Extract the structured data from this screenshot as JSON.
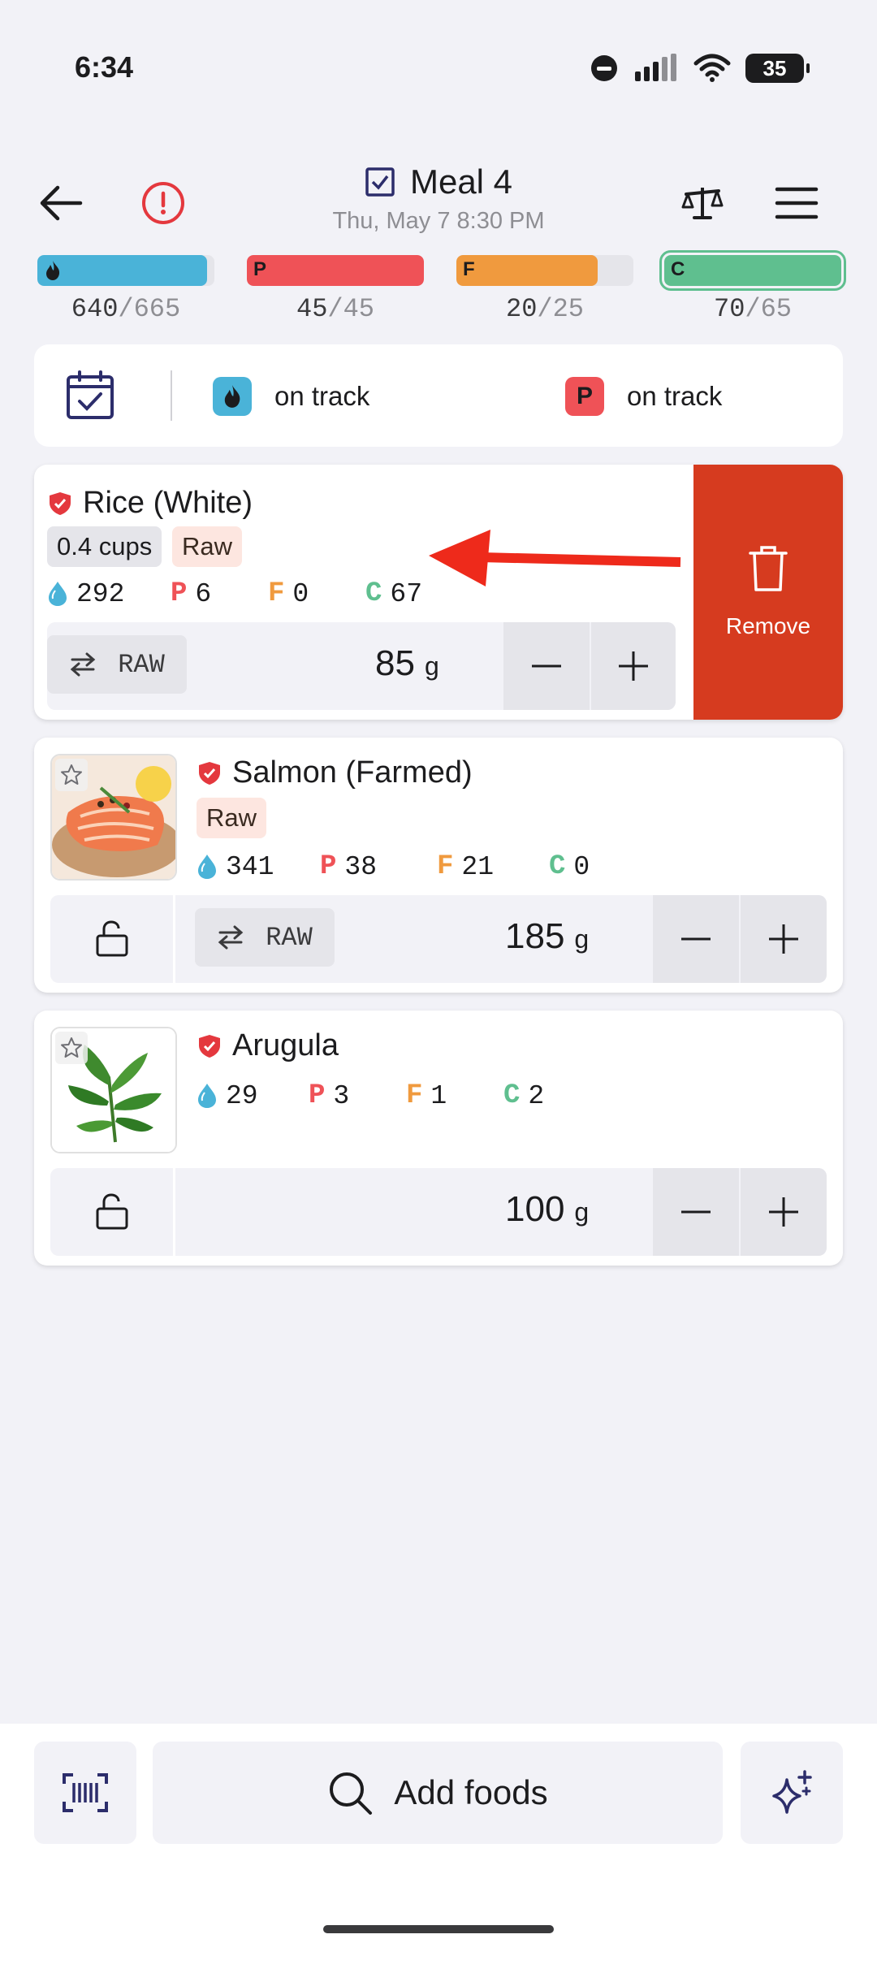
{
  "status_bar": {
    "time": "6:34",
    "battery": "35"
  },
  "header": {
    "title": "Meal 4",
    "subtitle": "Thu, May 7 8:30 PM",
    "icons": [
      "back-arrow-icon",
      "info-icon",
      "scale-icon",
      "menu-icon"
    ]
  },
  "macros": [
    {
      "key": "cal",
      "letter": "",
      "current": "640",
      "target": "665",
      "fraction": 0.96,
      "color": "#4ab3d8"
    },
    {
      "key": "protein",
      "letter": "P",
      "current": "45",
      "target": "45",
      "fraction": 1.0,
      "color": "#ef5257"
    },
    {
      "key": "fat",
      "letter": "F",
      "current": "20",
      "target": "25",
      "fraction": 0.8,
      "color": "#f09a3e"
    },
    {
      "key": "carb",
      "letter": "C",
      "current": "70",
      "target": "65",
      "fraction": 1.0,
      "color": "#5fbf8f"
    }
  ],
  "tracking": {
    "calories_status": "on track",
    "protein_letter": "P",
    "protein_status": "on track"
  },
  "foods": [
    {
      "name": "Rice (White)",
      "portion_tag": "0.4 cups",
      "state_tag": "Raw",
      "cal": "292",
      "protein": "6",
      "fat": "0",
      "carb": "67",
      "raw_label": "RAW",
      "quantity": "85",
      "unit": "g",
      "remove_label": "Remove"
    },
    {
      "name": "Salmon (Farmed)",
      "state_tag": "Raw",
      "cal": "341",
      "protein": "38",
      "fat": "21",
      "carb": "0",
      "raw_label": "RAW",
      "quantity": "185",
      "unit": "g"
    },
    {
      "name": "Arugula",
      "cal": "29",
      "protein": "3",
      "fat": "1",
      "carb": "2",
      "quantity": "100",
      "unit": "g"
    }
  ],
  "labels": {
    "p": "P",
    "f": "F",
    "c": "C"
  },
  "bottom": {
    "add_label": "Add foods"
  },
  "colors": {
    "cal": "#4ab3d8",
    "protein": "#ef5257",
    "fat": "#f09a3e",
    "carb": "#5fbf8f",
    "remove": "#d63b1f",
    "arrow": "#ee2a1b"
  }
}
